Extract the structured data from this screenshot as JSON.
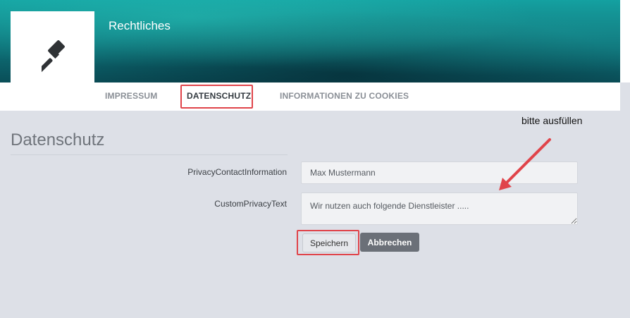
{
  "header": {
    "title": "Rechtliches",
    "logo_icon": "gavel-icon"
  },
  "tabs": [
    {
      "label": "IMPRESSUM",
      "active": false
    },
    {
      "label": "DATENSCHUTZ",
      "active": true
    },
    {
      "label": "INFORMATIONEN ZU COOKIES",
      "active": false
    }
  ],
  "section": {
    "title": "Datenschutz"
  },
  "form": {
    "contact_label": "PrivacyContactInformation",
    "contact_value": "Max Mustermann",
    "custom_text_label": "CustomPrivacyText",
    "custom_text_value": "Wir nutzen auch folgende Dienstleister ....."
  },
  "buttons": {
    "save_label": "Speichern",
    "cancel_label": "Abbrechen"
  },
  "annotation": {
    "text": "bitte ausfüllen"
  },
  "colors": {
    "highlight": "#e0444a",
    "banner": "#0e7a80",
    "background": "#dde0e7"
  }
}
